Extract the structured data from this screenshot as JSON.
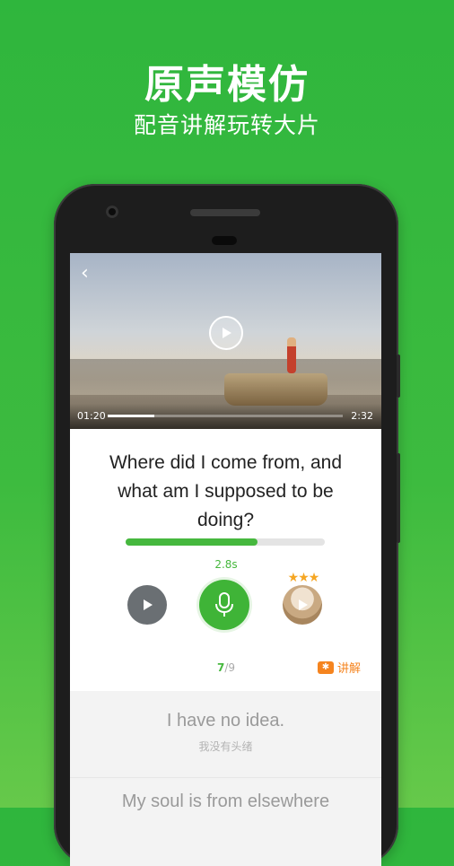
{
  "promo": {
    "title": "原声模仿",
    "subtitle": "配音讲解玩转大片"
  },
  "video": {
    "current_time": "01:20",
    "total_time": "2:32",
    "progress_fraction": 0.2
  },
  "sentence": {
    "text": "Where did I come from, and what am I supposed to be doing?"
  },
  "recording": {
    "progress_fraction": 0.66,
    "duration": "2.8s",
    "stars": "★★★"
  },
  "counter": {
    "current": "7",
    "total": "/9"
  },
  "explain": {
    "label": "讲解",
    "icon": "chat-bubble-icon"
  },
  "list": {
    "items": [
      {
        "en": "I have no idea.",
        "cn": "我没有头绪"
      },
      {
        "en": "My soul is from elsewhere",
        "cn": ""
      }
    ]
  },
  "colors": {
    "accent": "#46b83e",
    "orange": "#f5841f",
    "star": "#f5a623"
  }
}
